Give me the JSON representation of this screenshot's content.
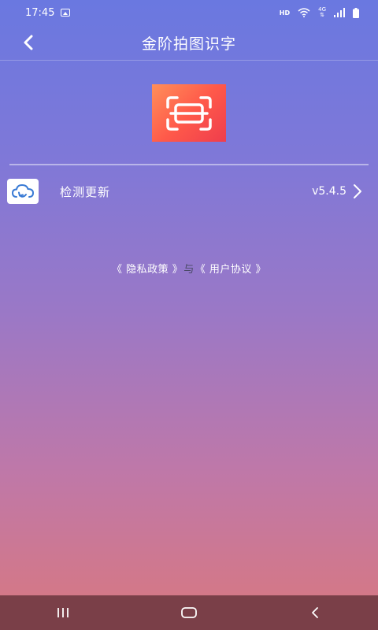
{
  "status_bar": {
    "time": "17:45",
    "hd": "HD",
    "net_top": "4G",
    "net_bottom": "⇅"
  },
  "header": {
    "title": "金阶拍图识字"
  },
  "update_row": {
    "label": "检测更新",
    "version": "v5.4.5"
  },
  "policy": {
    "privacy": "《 隐私政策 》",
    "separator": "与",
    "agreement": "《 用户协议 》"
  },
  "icons": {
    "back": "chevron-left-icon",
    "cloud": "cloud-refresh-icon",
    "more": "chevron-right-icon",
    "nav_recent": "recent-apps-icon",
    "nav_home": "home-icon",
    "nav_back": "back-icon"
  },
  "colors": {
    "logo": "#ff5a4a",
    "nav_bar": "#7a3f48",
    "gradient_top": "#6a78e0",
    "gradient_bottom": "#d9787f"
  }
}
